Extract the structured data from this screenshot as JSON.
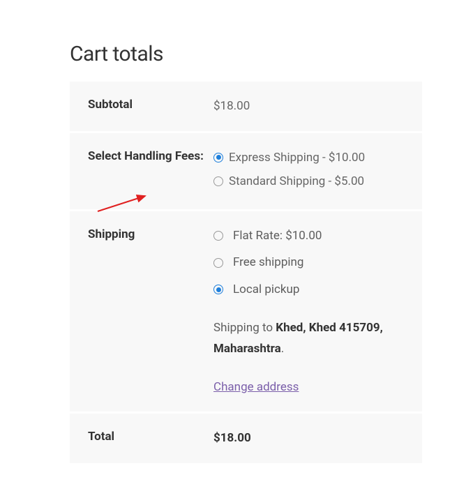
{
  "heading": "Cart totals",
  "subtotal": {
    "label": "Subtotal",
    "value": "$18.00"
  },
  "handling": {
    "label": "Select Handling Fees:",
    "options": [
      {
        "label": "Express Shipping - $10.00",
        "checked": true
      },
      {
        "label": "Standard Shipping - $5.00",
        "checked": false
      }
    ]
  },
  "shipping": {
    "label": "Shipping",
    "options": [
      {
        "label": "Flat Rate: $10.00",
        "checked": false
      },
      {
        "label": "Free shipping",
        "checked": false
      },
      {
        "label": "Local pickup",
        "checked": true
      }
    ],
    "dest_prefix": "Shipping to ",
    "dest_bold": "Khed, Khed 415709, Maharashtra",
    "dest_suffix": ".",
    "change_link": "Change address"
  },
  "total": {
    "label": "Total",
    "value": "$18.00"
  }
}
